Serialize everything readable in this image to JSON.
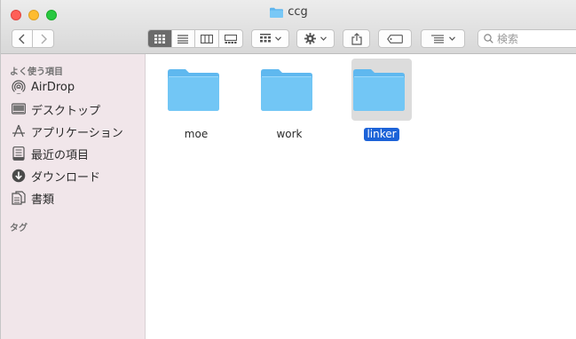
{
  "window": {
    "title": "ccg"
  },
  "toolbar": {
    "search_placeholder": "検索"
  },
  "sidebar": {
    "favorites_heading": "よく使う項目",
    "items": [
      {
        "label": "AirDrop",
        "icon": "airdrop-icon"
      },
      {
        "label": "デスクトップ",
        "icon": "desktop-icon"
      },
      {
        "label": "アプリケーション",
        "icon": "applications-icon"
      },
      {
        "label": "最近の項目",
        "icon": "recents-icon"
      },
      {
        "label": "ダウンロード",
        "icon": "downloads-icon"
      },
      {
        "label": "書類",
        "icon": "documents-icon"
      }
    ],
    "tags_heading": "タグ"
  },
  "content": {
    "items": [
      {
        "name": "moe",
        "selected": false
      },
      {
        "name": "work",
        "selected": false
      },
      {
        "name": "linker",
        "selected": true
      }
    ]
  },
  "colors": {
    "folder_blue": "#66c3f6",
    "selection_blue": "#1c63d8",
    "sidebar_bg": "#f1e6ea"
  }
}
